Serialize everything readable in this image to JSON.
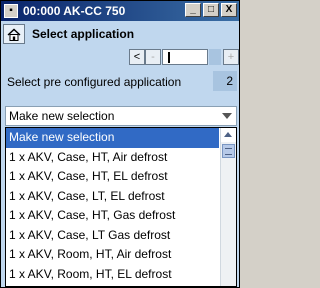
{
  "window": {
    "title": "00:000 AK-CC 750",
    "minimize": "_",
    "maximize": "□",
    "close": "X"
  },
  "header": {
    "title": "Select application"
  },
  "pager": {
    "prev": "<",
    "back": "-",
    "next": "+"
  },
  "preconfigured": {
    "label": "Select pre configured application",
    "value": "2"
  },
  "select": {
    "value": "Make new selection"
  },
  "options": [
    "Make new selection",
    "1 x AKV, Case, HT, Air defrost",
    "1 x AKV, Case, HT, EL defrost",
    "1 x AKV, Case, LT, EL defrost",
    "1 x AKV, Case, HT, Gas defrost",
    "1 x AKV, Case, LT Gas defrost",
    "1 x AKV, Room, HT, Air defrost",
    "1 x AKV, Room, HT, EL defrost"
  ],
  "colors": {
    "titlebar": "#0a246a",
    "background": "#c0d7ee",
    "selection": "#316ac5"
  }
}
